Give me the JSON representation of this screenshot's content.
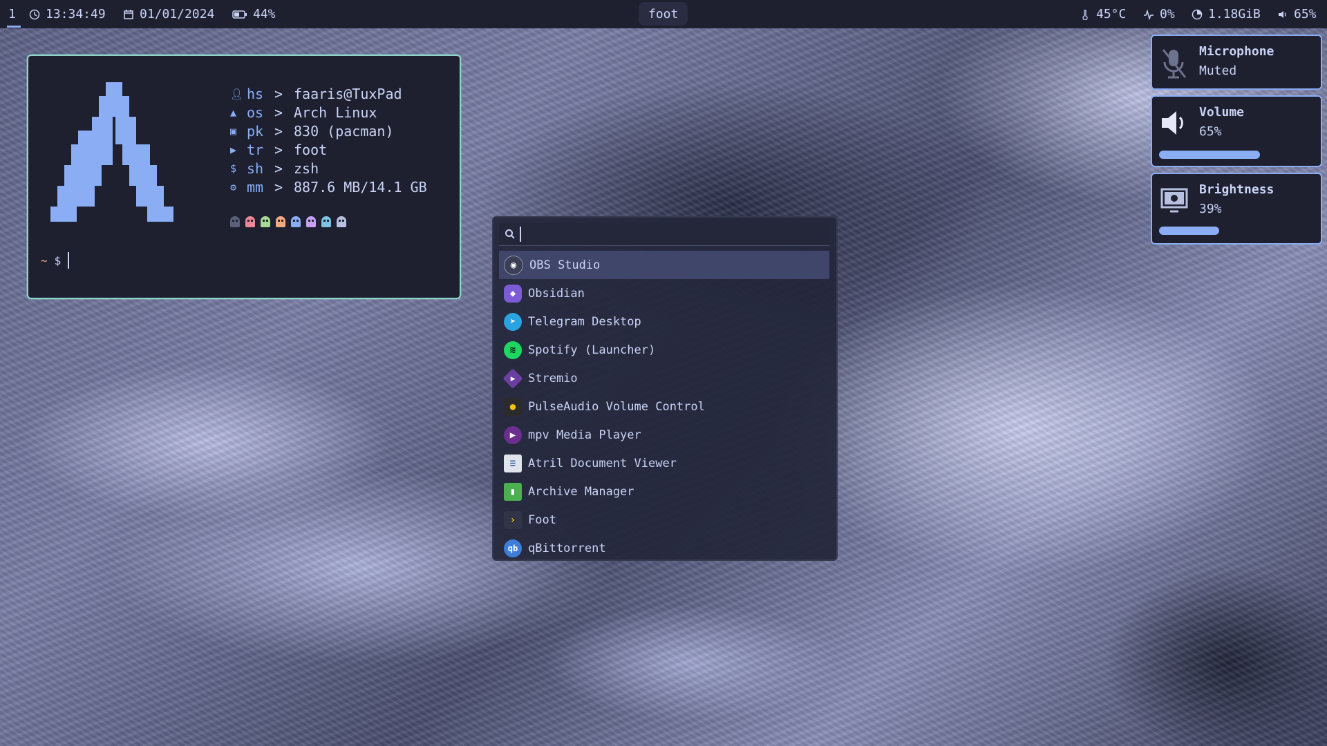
{
  "topbar": {
    "workspace": "1",
    "time": "13:34:49",
    "date": "01/01/2024",
    "battery": "44%",
    "window_title": "foot",
    "temperature": "45°C",
    "cpu": "0%",
    "memory": "1.18GiB",
    "volume": "65%"
  },
  "terminal": {
    "info": [
      {
        "icon": "user-icon",
        "key": "hs",
        "value": "faaris@TuxPad"
      },
      {
        "icon": "arch-icon",
        "key": "os",
        "value": "Arch Linux"
      },
      {
        "icon": "package-icon",
        "key": "pk",
        "value": "830 (pacman)"
      },
      {
        "icon": "terminal-icon",
        "key": "tr",
        "value": "foot"
      },
      {
        "icon": "dollar-icon",
        "key": "sh",
        "value": "zsh"
      },
      {
        "icon": "memory-icon",
        "key": "mm",
        "value": "887.6 MB/14.1 GB"
      }
    ],
    "arrow": ">",
    "prompt_dir": "~",
    "prompt_symbol": "$",
    "ghost_colors": [
      "#5b6078",
      "#ed8796",
      "#a6da95",
      "#f5a97f",
      "#8aadf4",
      "#c6a0f6",
      "#7dc4e4",
      "#b8c0e0"
    ]
  },
  "launcher": {
    "search_value": "",
    "entries": [
      {
        "label": "OBS Studio",
        "icon": "obs-icon",
        "color": "#3b3f55",
        "glyph": "◉"
      },
      {
        "label": "Obsidian",
        "icon": "obsidian-icon",
        "color": "#7c5bd6",
        "glyph": "◆"
      },
      {
        "label": "Telegram Desktop",
        "icon": "telegram-icon",
        "color": "#2aa3e0",
        "glyph": "➤"
      },
      {
        "label": "Spotify (Launcher)",
        "icon": "spotify-icon",
        "color": "#1ed760",
        "glyph": "≋"
      },
      {
        "label": "Stremio",
        "icon": "stremio-icon",
        "color": "#6b3fa0",
        "glyph": "▶"
      },
      {
        "label": "PulseAudio Volume Control",
        "icon": "pulseaudio-icon",
        "color": "#2b2b2b",
        "glyph": "●"
      },
      {
        "label": "mpv Media Player",
        "icon": "mpv-icon",
        "color": "#6b2f8f",
        "glyph": "▶"
      },
      {
        "label": "Atril Document Viewer",
        "icon": "atril-icon",
        "color": "#dfe3ec",
        "glyph": "≡"
      },
      {
        "label": "Archive Manager",
        "icon": "archive-icon",
        "color": "#4caf50",
        "glyph": "▮"
      },
      {
        "label": "Foot",
        "icon": "foot-icon",
        "color": "#303446",
        "glyph": "›"
      },
      {
        "label": "qBittorrent",
        "icon": "qbittorrent-icon",
        "color": "#3d7ed8",
        "glyph": "qb"
      }
    ]
  },
  "osd": {
    "microphone": {
      "title": "Microphone",
      "status": "Muted"
    },
    "volume": {
      "title": "Volume",
      "value": "65%",
      "level": 0.65
    },
    "brightness": {
      "title": "Brightness",
      "value": "39%",
      "level": 0.39
    }
  },
  "colors": {
    "accent": "#8aadf4",
    "terminal_border": "#8bd5ca",
    "selection": "#40456a"
  }
}
